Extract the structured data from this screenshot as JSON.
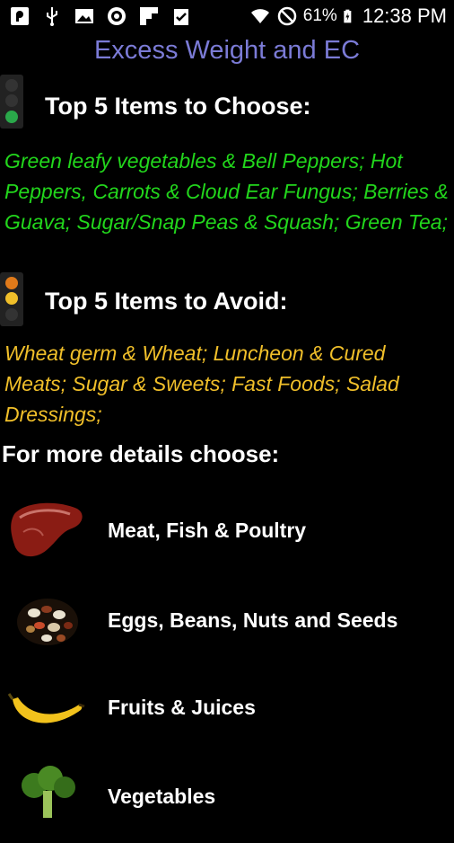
{
  "status_bar": {
    "battery": "61%",
    "time": "12:38 PM",
    "icons": [
      "notification-icon",
      "usb-icon",
      "image-icon",
      "settings-icon",
      "flipboard-icon",
      "clipboard-icon",
      "wifi-icon",
      "no-signal-icon",
      "battery-icon"
    ]
  },
  "header": {
    "title": "Excess Weight and EC"
  },
  "choose": {
    "title": "Top 5 Items to Choose:",
    "text": "Green leafy vegetables & Bell Peppers; Hot Peppers, Carrots & Cloud Ear Fungus; Berries & Guava; Sugar/Snap Peas & Squash; Green Tea;",
    "color": "#22d61c",
    "icon": "green-traffic-light-icon"
  },
  "avoid": {
    "title": "Top 5 Items to Avoid:",
    "text": "Wheat germ & Wheat; Luncheon & Cured Meats; Sugar & Sweets; Fast Foods; Salad Dressings;",
    "color": "#f0bf2a",
    "icon": "yellow-traffic-light-icon"
  },
  "more_details": {
    "label": "For more details choose:"
  },
  "categories": [
    {
      "label": "Meat, Fish & Poultry",
      "icon": "steak-icon"
    },
    {
      "label": "Eggs, Beans, Nuts and Seeds",
      "icon": "beans-icon"
    },
    {
      "label": "Fruits & Juices",
      "icon": "banana-icon"
    },
    {
      "label": "Vegetables",
      "icon": "broccoli-icon"
    }
  ]
}
